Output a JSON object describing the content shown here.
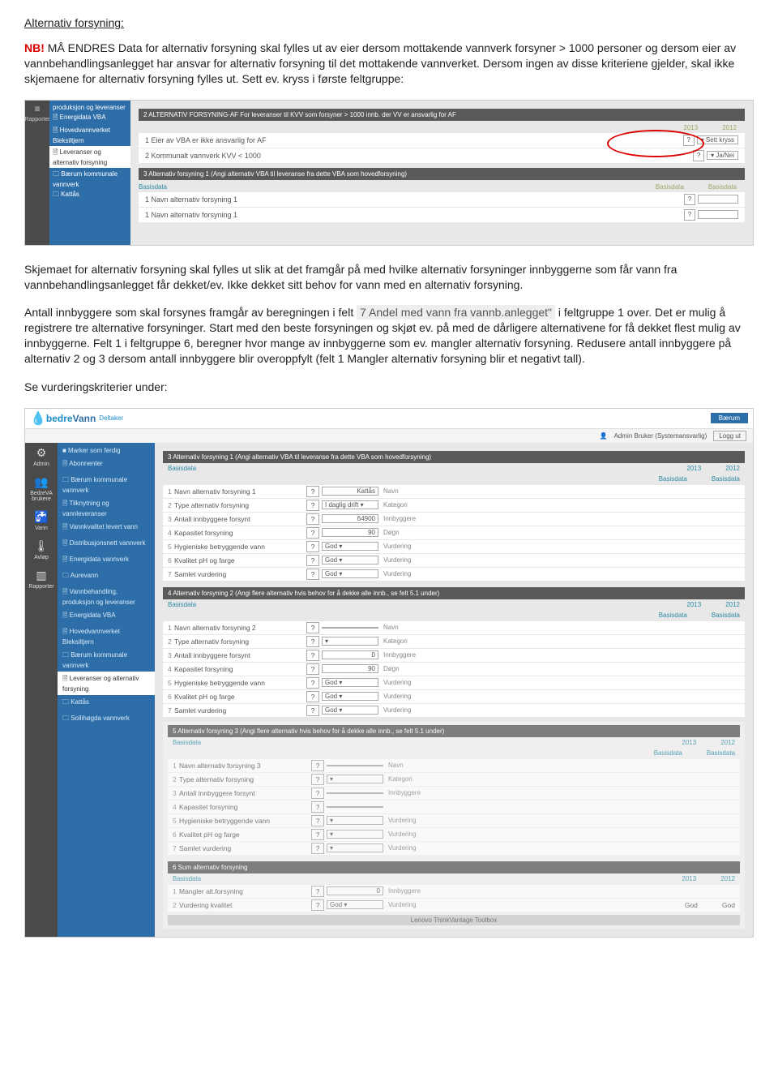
{
  "doc": {
    "title": "Alternativ forsyning:",
    "nb_prefix": "NB!",
    "p1_rest": " MÅ ENDRES Data for alternativ forsyning skal fylles ut av eier dersom mottakende vannverk forsyner > 1000 personer og dersom eier av vannbehandlingsanlegget har ansvar for alternativ forsyning til det mottakende vannverket. Dersom ingen av disse kriteriene gjelder, skal ikke skjemaene for alternativ forsyning fylles ut. Sett ev. kryss i første feltgruppe:",
    "p2": "Skjemaet for alternativ forsyning skal fylles ut slik at det framgår på med hvilke alternativ forsyninger innbyggerne som får vann fra vannbehandlingsanlegget får dekket/ev. Ikke dekket sitt behov for vann med en alternativ forsyning.",
    "p3a": "Antall innbyggere som skal forsynes framgår av beregningen i felt ",
    "p3_code": "7 Andel med vann fra vannb.anlegget\"",
    "p3b": " i feltgruppe 1 over. Det er mulig å registrere tre alternative forsyninger. Start med den beste forsyningen og skjøt ev. på med de dårligere alternativene for få dekket flest mulig av innbyggerne. Felt 1 i feltgruppe 6, beregner hvor mange av innbyggerne som ev. mangler alternativ forsyning. Redusere antall innbyggere på alternativ 2 og 3 dersom antall innbyggere blir overoppfylt (felt 1 Mangler alternativ forsyning blir et negativt tall).",
    "p4": "Se vurderingskriterier under:"
  },
  "ss1": {
    "rail": {
      "rapporter": "Rapporter"
    },
    "sidebar": {
      "i1": "produksjon og leveranser",
      "i2": "🗎 Energidata VBA",
      "i3": "🗎 Hovedvannverket Bleksiltjern",
      "i4": "🗎 Leveranser og alternativ forsyning",
      "i5": "🗀 Bærum kommunale vannverk",
      "i6": "🗀 Kattås"
    },
    "hdr2": "2  ALTERNATIV FORSYNING-AF  For leveranser til KVV som forsyner > 1000 innb. der VV er ansvarlig for AF",
    "y2013": "2013",
    "y2012": "2012",
    "r1": "1 Eier av VBA er ikke ansvarlig for AF",
    "r1opt": "Sett kryss",
    "r2": "2 Kommunalt vannverk KVV < 1000",
    "r2opt": "Ja/Nei",
    "hdr3": "3  Alternativ forsyning 1 (Angi alternativ VBA til leveranse fra dette VBA som hovedforsyning)",
    "basis": "Basisdata",
    "r3a": "1 Navn alternativ forsyning 1",
    "r3b": "1 Navn alternativ forsyning 1"
  },
  "ss2": {
    "app": {
      "brand1": "bedre",
      "brand2": "Vann",
      "deltaker": "Deltaker",
      "topbtn": "Bærum",
      "user": "Admin Bruker (Systemansvarlig)",
      "logout": "Logg ut"
    },
    "rail": {
      "admin": "Admin",
      "bedreva": "BedreVA brukere",
      "vann": "Vann",
      "avlop": "Avløp",
      "rapporter": "Rapporter"
    },
    "sidebar": [
      "■ Marker som ferdig",
      "🗎 Abonnenter",
      "🗀 Bærum kommunale vannverk",
      "🗎 Tilknytning og vannleveranser",
      "🗎 Vannkvalitet levert vann",
      "🗎 Distribusjonsnett vannverk",
      "🗎 Energidata vannverk",
      "🗀 Aurevann",
      "🗎 Vannbehandling, produksjon og leveranser",
      "🗎 Energidata VBA",
      "🗎 Hovedvannverket Bleksiltjern",
      "🗀 Bærum kommunale vannverk",
      "🗎 Leveranser og alternativ forsyning",
      "🗀 Kattås",
      "🗀 Sollihøgda vannverk"
    ],
    "sidebar_active_idx": 12,
    "y2013": "2013",
    "y2012": "2012",
    "basis": "Basisdata",
    "g3": {
      "title": "3  Alternativ forsyning 1 (Angi alternativ VBA til leveranse fra dette VBA som hovedforsyning)",
      "r1": "Navn alternativ forsyning 1",
      "r1v": "Kattås",
      "r1u": "Navn",
      "r2": "Type alternativ forsyning",
      "r2v": "I daglig drift",
      "r2u": "Kategori",
      "r3": "Antall innbyggere forsynt",
      "r3v": "64900",
      "r3u": "Innbyggere",
      "r4": "Kapasitet forsyning",
      "r4v": "90",
      "r4u": "Døgn",
      "r5": "Hygieniske betryggende vann",
      "r5v": "God",
      "r5u": "Vurdering",
      "r6": "Kvalitet pH og farge",
      "r6v": "God",
      "r6u": "Vurdering",
      "r7": "Samlet vurdering",
      "r7v": "God",
      "r7u": "Vurdering"
    },
    "g4": {
      "title": "4  Alternativ forsyning 2 (Angi flere alternativ hvis behov for å dekke alle innb., se felt 5.1 under)",
      "r1": "Navn alternativ forsyning 2",
      "r1v": "",
      "r1u": "Navn",
      "r2": "Type alternativ forsyning",
      "r2v": "",
      "r2u": "Kategori",
      "r3": "Antall innbyggere forsynt",
      "r3v": "0",
      "r3u": "Innbyggere",
      "r4": "Kapasitet forsyning",
      "r4v": "90",
      "r4u": "Døgn",
      "r5": "Hygieniske betryggende vann",
      "r5v": "God",
      "r5u": "Vurdering",
      "r6": "Kvalitet pH og farge",
      "r6v": "God",
      "r6u": "Vurdering",
      "r7": "Samlet vurdering",
      "r7v": "God",
      "r7u": "Vurdering"
    },
    "g5": {
      "title": "5  Alternativ forsyning 3 (Angi flere alternativ hvis behov for å dekke alle innb., se felt 5.1 under)",
      "r1": "Navn alternativ forsyning 3",
      "r1u": "Navn",
      "r2": "Type alternativ forsyning",
      "r2u": "Kategori",
      "r3": "Antall innbyggere forsynt",
      "r3u": "Innbyggere",
      "r4": "Kapasitet forsyning",
      "r4u": "",
      "r5": "Hygieniske betryggende vann",
      "r5u": "Vurdering",
      "r6": "Kvalitet pH og farge",
      "r6u": "Vurdering",
      "r7": "Samlet vurdering",
      "r7u": "Vurdering"
    },
    "g6": {
      "title": "6  Sum alternativ forsyning",
      "r1": "Mangler alt.forsyning",
      "r1v": "0",
      "r1u": "Innbyggere",
      "r2": "Vurdering kvalitet",
      "r2v": "God",
      "r2u": "Vurdering",
      "r2_2013": "God",
      "r2_2012": "God"
    },
    "taskbar": "Lenovo ThinkVantage Toolbox"
  },
  "q": "?"
}
